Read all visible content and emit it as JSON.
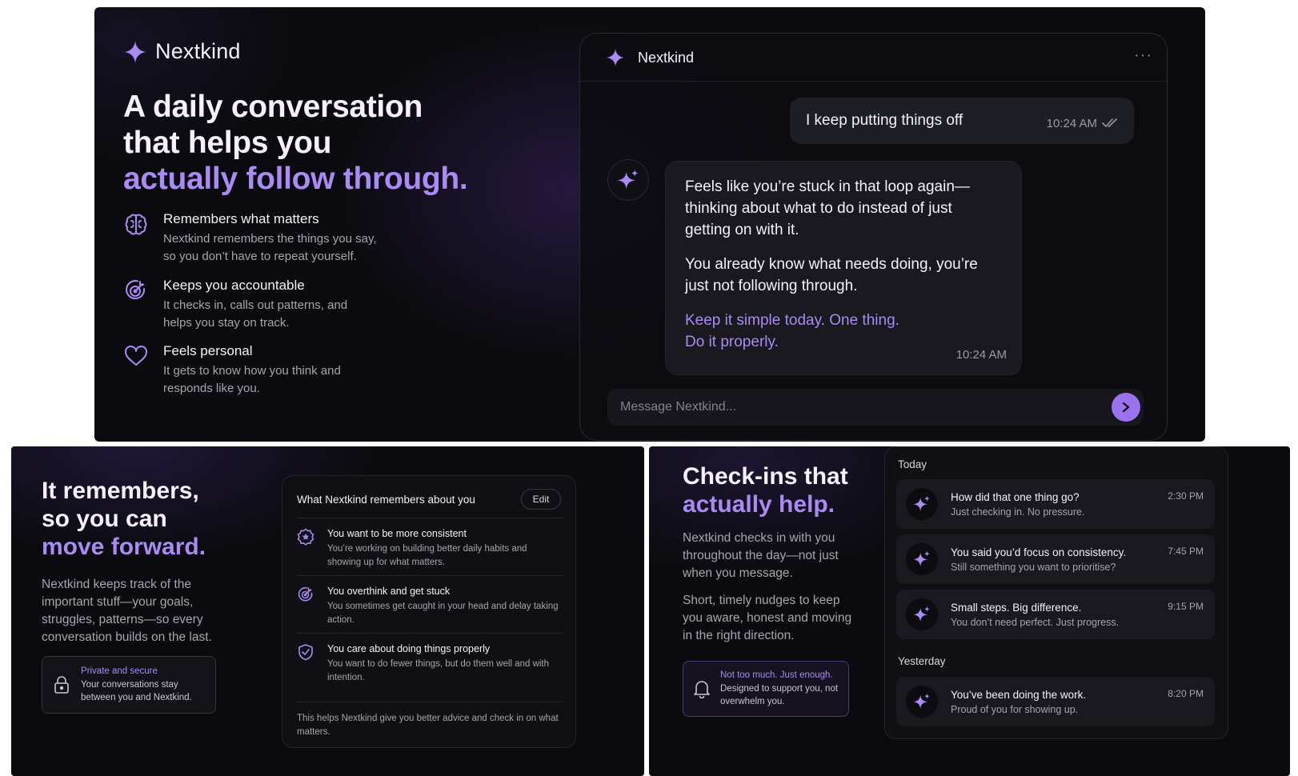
{
  "colors": {
    "accent": "#a98bf3",
    "accent_button": "#9b73f0",
    "background": "#0b0b0f"
  },
  "hero": {
    "brand": "Nextkind",
    "title_line1": "A daily conversation",
    "title_line2": "that helps you",
    "title_line3": "actually follow through.",
    "features": [
      {
        "icon": "brain-icon",
        "title": "Remembers what matters",
        "desc": "Nextkind remembers the things you say, so you don’t have to repeat yourself."
      },
      {
        "icon": "target-icon",
        "title": "Keeps you accountable",
        "desc": "It checks in, calls out patterns, and helps you stay on track."
      },
      {
        "icon": "heart-icon",
        "title": "Feels personal",
        "desc": "It gets to know how you think and responds like you."
      }
    ]
  },
  "chat": {
    "title": "Nextkind",
    "more": "···",
    "user_message": {
      "text": "I keep putting things off",
      "time": "10:24 AM"
    },
    "bot_message": {
      "p1": "Feels like you’re stuck in that loop again—thinking about what to do instead of just getting on with it.",
      "p2": "You already know what needs doing, you’re just not following through.",
      "p3_line1": "Keep it simple today. One thing.",
      "p3_line2": "Do it properly.",
      "time": "10:24 AM"
    },
    "composer_placeholder": "Message Nextkind..."
  },
  "memory": {
    "title_line1": "It remembers,",
    "title_line2": "so you can",
    "title_line3": "move forward.",
    "desc": "Nextkind keeps track of the important stuff—your goals, struggles, patterns—so every conversation builds on the last.",
    "privacy_title": "Private and secure",
    "privacy_desc": "Your conversations stay between you and Nextkind.",
    "card_title": "What Nextkind remembers about you",
    "edit_label": "Edit",
    "items": [
      {
        "icon": "star-badge-icon",
        "title": "You want to be more consistent",
        "desc": "You’re working on building better daily habits and showing up for what matters."
      },
      {
        "icon": "target-icon",
        "title": "You overthink and get stuck",
        "desc": "You sometimes get caught in your head and delay taking action."
      },
      {
        "icon": "shield-check-icon",
        "title": "You care about doing things properly",
        "desc": "You want to do fewer things, but do them well and with intention."
      }
    ],
    "footer": "This helps Nextkind give you better advice and check in on what matters."
  },
  "checkins": {
    "title_line1": "Check-ins that",
    "title_line2": "actually help.",
    "desc1": "Nextkind checks in with you throughout the day—not just when you message.",
    "desc2": "Short, timely nudges to keep you aware, honest and moving in the right direction.",
    "nudge_title": "Not too much. Just enough.",
    "nudge_desc": "Designed to support you, not overwhelm you.",
    "today_label": "Today",
    "yesterday_label": "Yesterday",
    "today": [
      {
        "title": "How did that one thing go?",
        "desc": "Just checking in. No pressure.",
        "time": "2:30 PM"
      },
      {
        "title": "You said you’d focus on consistency.",
        "desc": "Still something you want to prioritise?",
        "time": "7:45 PM"
      },
      {
        "title": "Small steps. Big difference.",
        "desc": "You don’t need perfect. Just progress.",
        "time": "9:15 PM"
      }
    ],
    "yesterday": [
      {
        "title": "You’ve been doing the work.",
        "desc": "Proud of you for showing up.",
        "time": "8:20 PM"
      }
    ]
  }
}
